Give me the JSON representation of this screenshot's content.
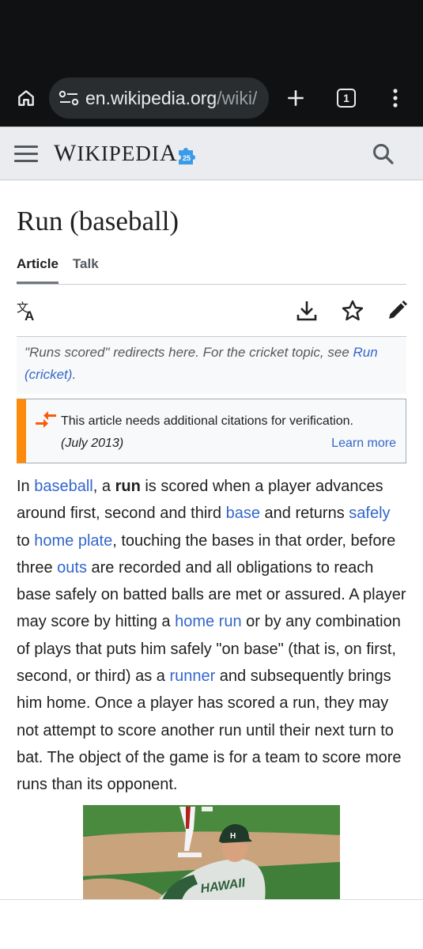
{
  "browser": {
    "url_host": "en.wikipedia.org",
    "url_path": "/wiki/",
    "tab_count": "1"
  },
  "wiki": {
    "wordmark": "Wikipedia",
    "wordmark_badge": "25"
  },
  "article": {
    "title": "Run (baseball)",
    "tabs": [
      {
        "label": "Article",
        "active": true
      },
      {
        "label": "Talk",
        "active": false
      }
    ],
    "hatnote": {
      "text": "\"Runs scored\" redirects here. For the cricket topic, see ",
      "link_line1": "Run",
      "link_line2": "(cricket)",
      "suffix": "."
    },
    "ambox": {
      "message": "This article needs additional citations for verification.",
      "date": "(July 2013)",
      "learn_more": "Learn more",
      "accent_color": "#fc8a0c"
    },
    "lead": {
      "t1": "In ",
      "l1": "baseball",
      "t2": ", a ",
      "b1": "run",
      "t3": " is scored when a player advances around first, second and third ",
      "l2": "base",
      "t4": " and returns ",
      "l3": "safely",
      "t5": " to ",
      "l4": "home plate",
      "t6": ", touching the bases in that order, before three ",
      "l5": "outs",
      "t7": " are recorded and all obligations to reach base safely on batted balls are met or assured. A player may score by hitting a ",
      "l6": "home run",
      "t8": " or by any combination of plays that puts him safely \"on base\" (that is, on first, second, or third) as a ",
      "l7": "runner",
      "t9": " and subsequently brings him home. Once a player has scored a run, they may not attempt to score another run until their next turn to bat. The object of the game is for a team to score more runs than its opponent."
    },
    "photo": {
      "jersey_text": "HAWAII",
      "cap_letter": "H"
    }
  },
  "colors": {
    "link": "#3366cc",
    "chrome_bg": "#0f1112",
    "header_bg": "#eaecf0"
  }
}
